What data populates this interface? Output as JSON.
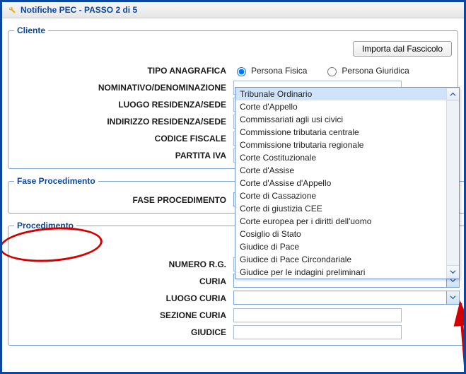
{
  "window": {
    "title": "Notifiche PEC - PASSO 2 di 5"
  },
  "cliente": {
    "legend": "Cliente",
    "import_button": "Importa dal Fascicolo",
    "labels": {
      "tipo_anagrafica": "TIPO ANAGRAFICA",
      "nominativo": "NOMINATIVO/DENOMINAZIONE",
      "luogo": "LUOGO RESIDENZA/SEDE",
      "indirizzo": "INDIRIZZO RESIDENZA/SEDE",
      "cf": "CODICE FISCALE",
      "piva": "PARTITA IVA"
    },
    "radio": {
      "fisica": "Persona Fisica",
      "giuridica": "Persona Giuridica"
    },
    "values": {
      "nominativo": "",
      "luogo": "",
      "indirizzo": "",
      "cf": "",
      "piva": ""
    }
  },
  "fase": {
    "legend": "Fase Procedimento",
    "labels": {
      "fase": "FASE PROCEDIMENTO"
    },
    "value": ""
  },
  "proc": {
    "legend": "Procedimento",
    "labels": {
      "numero_rg": "NUMERO R.G.",
      "curia": "CURIA",
      "luogo_curia": "LUOGO CURIA",
      "sezione_curia": "SEZIONE CURIA",
      "giudice": "GIUDICE"
    },
    "values": {
      "numero_rg": "",
      "curia": "",
      "luogo_curia": "",
      "sezione_curia": "",
      "giudice": ""
    }
  },
  "curia_options": [
    "Tribunale Ordinario",
    "Corte d'Appello",
    "Commissariati agli usi civici",
    "Commissione tributaria centrale",
    "Commissione tributaria regionale",
    "Corte Costituzionale",
    "Corte d'Assise",
    "Corte d'Assise d'Appello",
    "Corte di Cassazione",
    "Corte di giustizia CEE",
    "Corte europea per i diritti dell'uomo",
    "Cosiglio di Stato",
    "Giudice di Pace",
    "Giudice di Pace Circondariale",
    "Giudice per le indagini preliminari"
  ]
}
